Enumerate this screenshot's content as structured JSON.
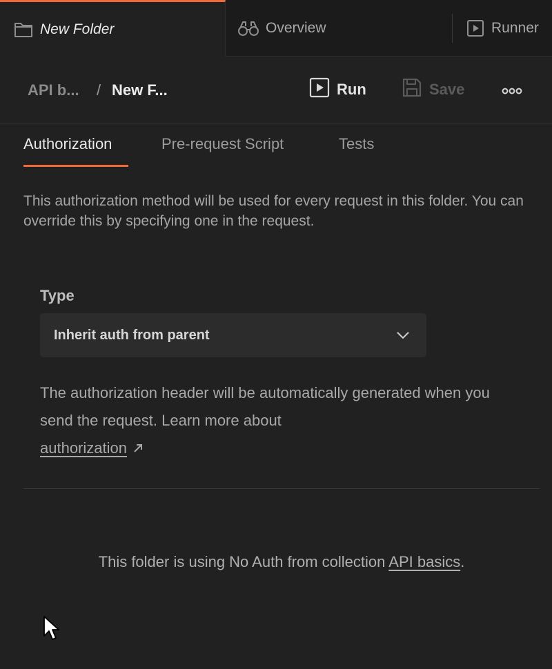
{
  "tabs": [
    {
      "label": "New Folder",
      "icon": "folder-icon",
      "active": true
    },
    {
      "label": "Overview",
      "icon": "binoculars-icon",
      "active": false
    },
    {
      "label": "Runner",
      "icon": "runner-icon",
      "active": false
    }
  ],
  "header": {
    "breadcrumb_parent": "API b...",
    "breadcrumb_separator": "/",
    "breadcrumb_current": "New F...",
    "run_label": "Run",
    "save_label": "Save",
    "more_icon": "more-horizontal-icon"
  },
  "subtabs": [
    {
      "label": "Authorization",
      "active": true
    },
    {
      "label": "Pre-request Script",
      "active": false
    },
    {
      "label": "Tests",
      "active": false
    }
  ],
  "auth": {
    "description": "This authorization method will be used for every request in this folder. You can override this by specifying one in the request.",
    "type_label": "Type",
    "type_value": "Inherit auth from parent",
    "help_text": "The authorization header will be automatically generated when you send the request. Learn more about ",
    "help_link": "authorization",
    "footer_prefix": "This folder is using No Auth from collection ",
    "footer_link": "API basics",
    "footer_suffix": "."
  },
  "colors": {
    "accent": "#ef6b3a",
    "background": "#212121",
    "tabstrip": "#1b1b1b"
  }
}
